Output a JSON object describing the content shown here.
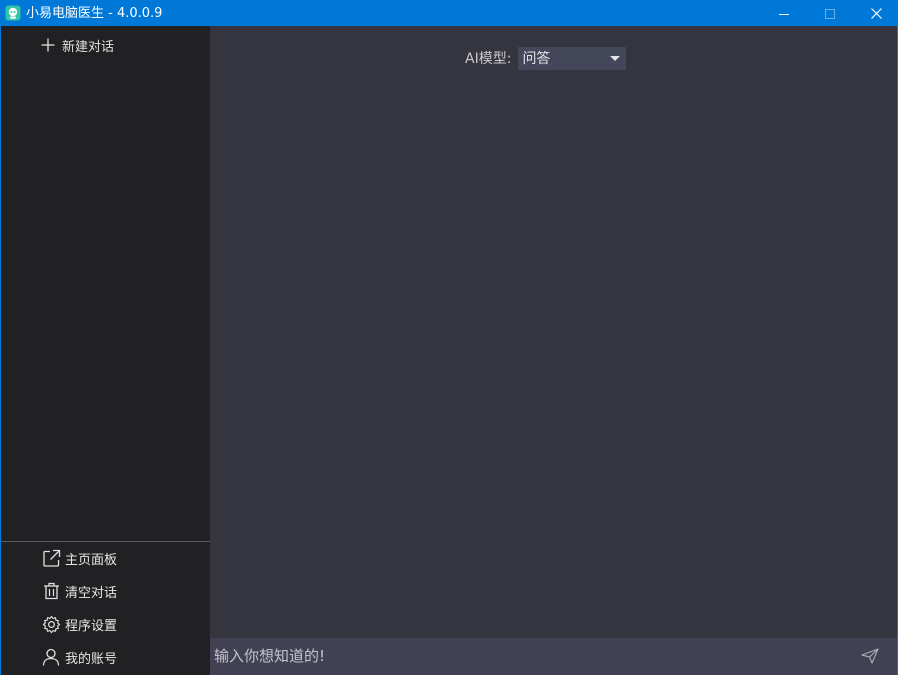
{
  "window": {
    "title": "小易电脑医生 - 4.0.0.9",
    "accent_color": "#0078d7"
  },
  "sidebar": {
    "new_chat_label": "新建对话",
    "new_chat_icon": "plus-icon",
    "bottom_items": [
      {
        "label": "主页面板",
        "icon": "external-link-icon"
      },
      {
        "label": "清空对话",
        "icon": "trash-icon"
      },
      {
        "label": "程序设置",
        "icon": "gear-icon"
      },
      {
        "label": "我的账号",
        "icon": "user-icon"
      }
    ]
  },
  "main": {
    "model_label": "AI模型:",
    "model_selected": "问答"
  },
  "input": {
    "placeholder": "输入你想知道的!",
    "send_icon": "send-icon"
  }
}
